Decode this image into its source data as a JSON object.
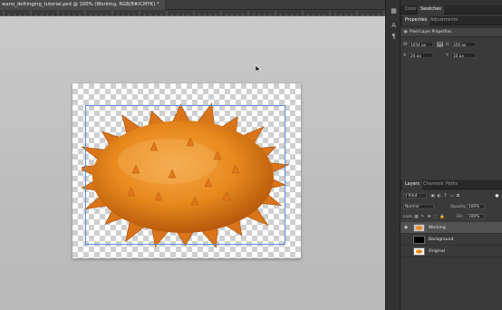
{
  "document": {
    "tab_title": "wano_defringing_tutorial.psd @ 100% (Working, RGB/8#/CMYK) *"
  },
  "panels_top": {
    "tabs": [
      {
        "label": "Color",
        "active": false
      },
      {
        "label": "Swatches",
        "active": true
      }
    ]
  },
  "properties": {
    "tabs": [
      {
        "label": "Properties",
        "active": true
      },
      {
        "label": "Adjustments",
        "active": false
      }
    ],
    "section_title": "Pixel Layer Properties",
    "w_label": "W:",
    "w_value": "1054 px",
    "go_label": "GO",
    "h_label": "H:",
    "h_value": "356 px",
    "x_label": "X:",
    "x_value": "20 px",
    "y_label": "Y:",
    "y_value": "10 px"
  },
  "layers_panel": {
    "tabs": [
      {
        "label": "Layers",
        "active": true
      },
      {
        "label": "Channels",
        "active": false
      },
      {
        "label": "Paths",
        "active": false
      }
    ],
    "filter_placeholder": "Kind",
    "blend_mode": "Normal",
    "opacity_label": "Opacity:",
    "opacity_value": "100%",
    "lock_label": "Lock:",
    "fill_label": "Fill:",
    "fill_value": "100%",
    "layers": [
      {
        "name": "Working",
        "selected": true,
        "visible": true,
        "thumb": "fruit"
      },
      {
        "name": "Background",
        "selected": false,
        "visible": false,
        "thumb": "black"
      },
      {
        "name": "Original",
        "selected": false,
        "visible": false,
        "thumb": "fruit"
      }
    ]
  },
  "colors": {
    "accent": "#5b8de0",
    "fruit_main": "#e98a1e",
    "fruit_dark": "#b85a0c"
  },
  "icons": [
    "arrow-cursor-icon",
    "history-icon",
    "character-icon",
    "paragraph-icon",
    "eye-icon",
    "chain-link-icon",
    "lock-icon",
    "search-icon"
  ]
}
